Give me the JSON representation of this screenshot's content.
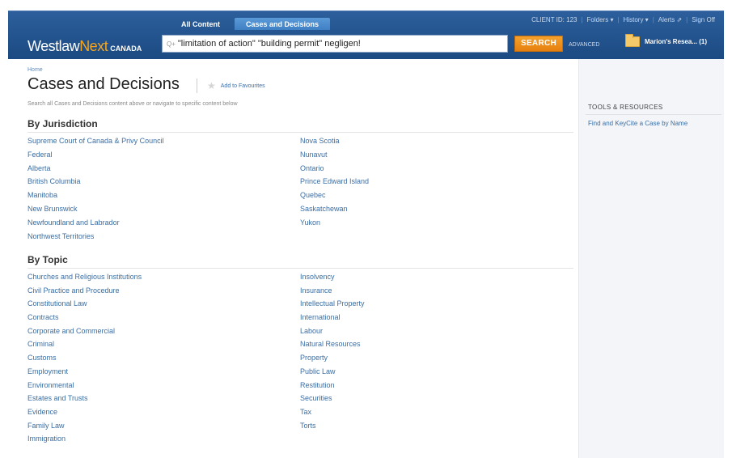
{
  "header": {
    "tabs": [
      "All Content",
      "Cases and Decisions"
    ],
    "active_tab": 1,
    "client_id": "CLIENT ID: 123",
    "folders": "Folders ▾",
    "history": "History ▾",
    "alerts": "Alerts",
    "sign_off": "Sign Off",
    "logo_westlaw": "Westlaw",
    "logo_next": "Next",
    "logo_canada": "CANADA",
    "search_value": "\"limitation of action\" \"building permit\" negligen!",
    "search_button": "SEARCH",
    "advanced": "ADVANCED",
    "folder_name": "Marion's Resea...  (1)"
  },
  "page": {
    "breadcrumb": "Home",
    "title": "Cases and Decisions",
    "favourites": "Add to Favourites",
    "subtitle": "Search all Cases and Decisions content above or navigate to specific content below"
  },
  "jurisdiction": {
    "heading": "By Jurisdiction",
    "col1": [
      "Supreme Court of Canada & Privy Council",
      "Federal",
      "Alberta",
      "British Columbia",
      "Manitoba",
      "New Brunswick",
      "Newfoundland and Labrador",
      "Northwest Territories"
    ],
    "col2": [
      "Nova Scotia",
      "Nunavut",
      "Ontario",
      "Prince Edward Island",
      "Quebec",
      "Saskatchewan",
      "Yukon"
    ]
  },
  "topic": {
    "heading": "By Topic",
    "col1": [
      "Churches and Religious Institutions",
      "Civil Practice and Procedure",
      "Constitutional Law",
      "Contracts",
      "Corporate and Commercial",
      "Criminal",
      "Customs",
      "Employment",
      "Environmental",
      "Estates and Trusts",
      "Evidence",
      "Family Law",
      "Immigration"
    ],
    "col2": [
      "Insolvency",
      "Insurance",
      "Intellectual Property",
      "International",
      "Labour",
      "Natural Resources",
      "Property",
      "Public Law",
      "Restitution",
      "Securities",
      "Tax",
      "Torts"
    ]
  },
  "sidebar": {
    "heading": "TOOLS & RESOURCES",
    "link": "Find and KeyCite a Case by Name"
  },
  "colors": {
    "header_blue": "#1c4a82",
    "active_tab": "#3f80c4",
    "link_blue": "#3a6ea5",
    "search_orange": "#e67f10",
    "logo_orange": "#f7a61b"
  }
}
